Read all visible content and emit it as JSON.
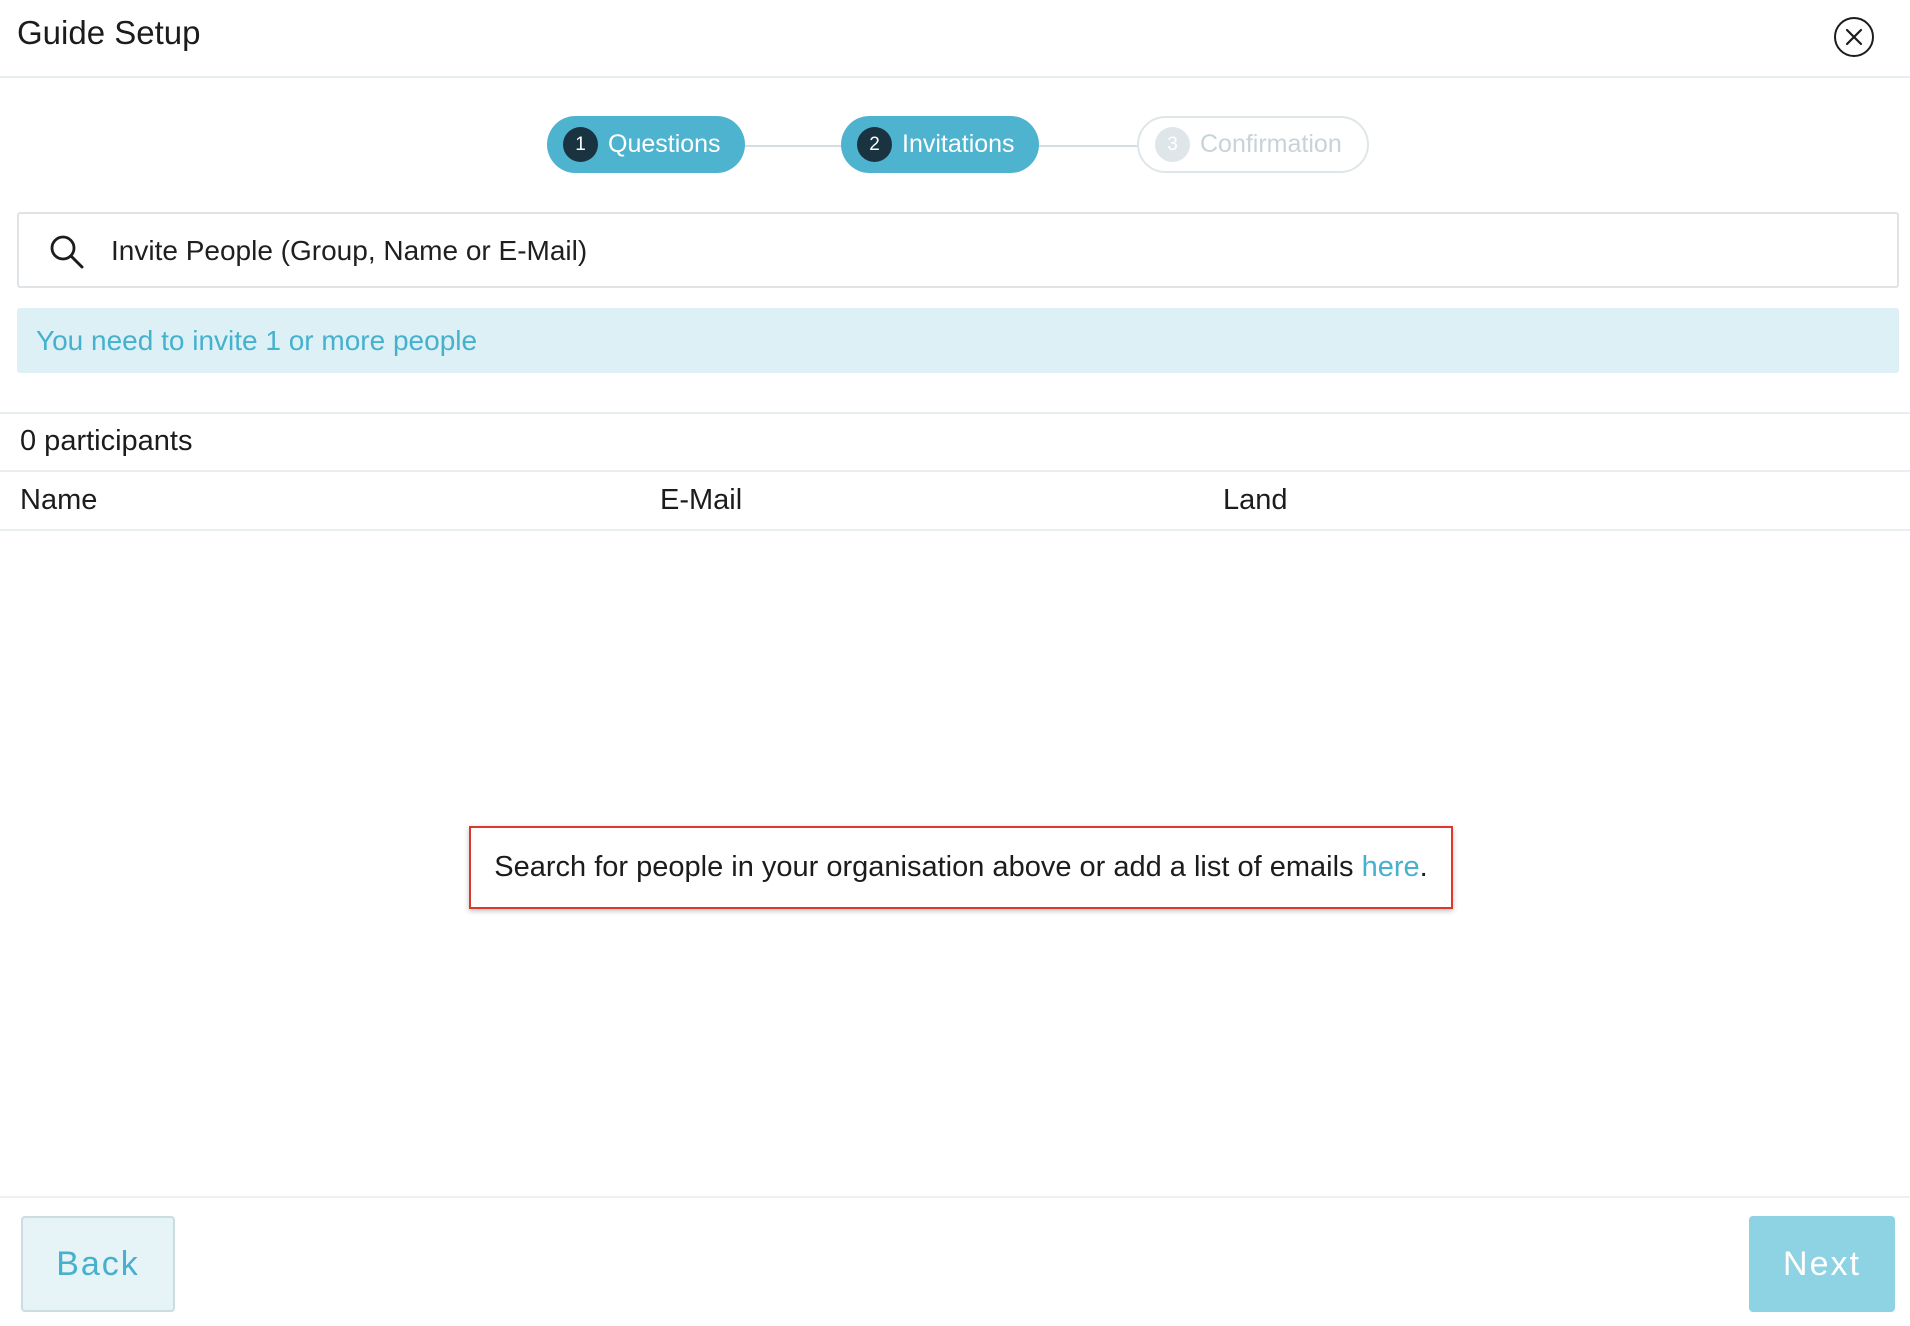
{
  "header": {
    "title": "Guide Setup",
    "close_icon": "close-circle-icon"
  },
  "stepper": {
    "steps": [
      {
        "number": "1",
        "label": "Questions",
        "state": "active"
      },
      {
        "number": "2",
        "label": "Invitations",
        "state": "active"
      },
      {
        "number": "3",
        "label": "Confirmation",
        "state": "inactive"
      }
    ]
  },
  "search": {
    "icon": "search-icon",
    "placeholder": "Invite People (Group, Name or E-Mail)",
    "value": ""
  },
  "alert": {
    "message": "You need to invite 1 or more people"
  },
  "participants": {
    "count_label": "0 participants",
    "columns": [
      "Name",
      "E-Mail",
      "Land"
    ],
    "rows": []
  },
  "empty_state": {
    "text": "Search for people in your organisation above or add a list of emails ",
    "link": "here",
    "suffix": "."
  },
  "footer": {
    "back_label": "Back",
    "next_label": "Next"
  },
  "colors": {
    "accent": "#4db3cf",
    "step_number_bg": "#1a3340",
    "alert_bg": "#ddf0f6",
    "alert_text": "#45b1cd",
    "highlight_border": "#d93a2b",
    "next_button": "#8dd3e4"
  }
}
